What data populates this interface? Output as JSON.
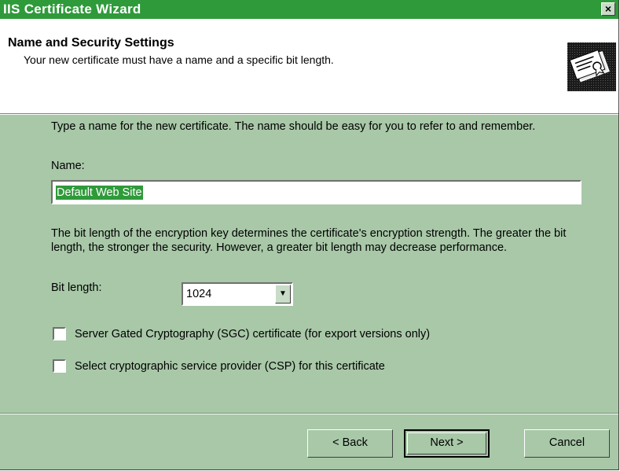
{
  "window": {
    "title": "IIS Certificate Wizard",
    "close_glyph": "×"
  },
  "header": {
    "title": "Name and Security Settings",
    "subtitle": "Your new certificate must have a name and a specific bit length.",
    "icon": "certificate-icon"
  },
  "name_section": {
    "description": "Type a name for the new certificate. The name should be easy for you to refer to and remember.",
    "label": "Name:",
    "value": "Default Web Site"
  },
  "bit_section": {
    "description": "The bit length of the encryption key determines the certificate's encryption strength. The greater the bit length, the stronger the security.  However, a greater bit length may decrease performance.",
    "label": "Bit length:",
    "value": "1024",
    "dropdown_glyph": "▼"
  },
  "options": {
    "sgc_label": "Server Gated Cryptography (SGC) certificate (for export versions only)",
    "sgc_checked": false,
    "csp_label": "Select cryptographic service provider (CSP) for this certificate",
    "csp_checked": false
  },
  "buttons": {
    "back": "< Back",
    "next": "Next >",
    "cancel": "Cancel"
  },
  "colors": {
    "title_bar": "#2f9a3a",
    "body": "#a8c8a8",
    "selection": "#2f9a3a"
  }
}
